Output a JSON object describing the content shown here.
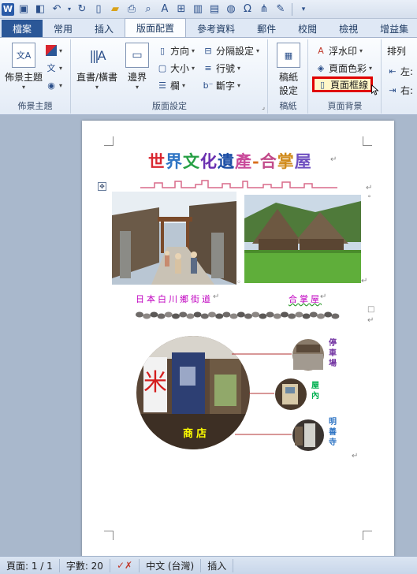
{
  "qat": {
    "icons": [
      "word-logo",
      "save-icon",
      "preview-icon",
      "undo-icon",
      "redo-icon",
      "new-doc-icon",
      "open-icon",
      "print-icon",
      "print-preview-icon",
      "text-box-icon",
      "table-icon",
      "book-icon",
      "image-icon",
      "omega-icon",
      "org-chart-icon",
      "highlighter-icon"
    ]
  },
  "tabs": {
    "file": "檔案",
    "home": "常用",
    "insert": "插入",
    "page_layout": "版面配置",
    "references": "參考資料",
    "mailings": "郵件",
    "review": "校閱",
    "view": "檢視",
    "addins": "增益集"
  },
  "ribbon": {
    "themes": {
      "themes_label": "佈景主題",
      "group_label": "佈景主題"
    },
    "page_setup": {
      "text_direction": "直書/橫書",
      "margins": "邊界",
      "orientation": "方向",
      "size": "大小",
      "columns": "欄",
      "breaks": "分隔設定",
      "line_numbers": "行號",
      "hyphenation": "斷字",
      "group_label": "版面設定"
    },
    "manuscript": {
      "button": "稿紙設定",
      "button_line1": "稿紙",
      "button_line2": "設定",
      "group_label": "稿紙"
    },
    "page_background": {
      "watermark": "浮水印",
      "page_color": "頁面色彩",
      "page_borders": "頁面框線",
      "group_label": "頁面背景"
    },
    "arrange": {
      "label": "排列",
      "indent_left": "左:",
      "indent_right": "右:"
    }
  },
  "document": {
    "title_chars": [
      "世",
      "界",
      "文",
      "化",
      "遺",
      "產",
      "-",
      "合",
      "掌",
      "屋"
    ],
    "title_colors": [
      "#d9262f",
      "#2e74c4",
      "#27a045",
      "#6a2fb0",
      "#1c4ea5",
      "#c94a9a",
      "#d96e1a",
      "#c24a8a",
      "#d08a1a",
      "#6f4fc0"
    ],
    "caption_left": "日本白川鄉街道",
    "caption_right": "合掌屋",
    "shop_label": "商店",
    "side_labels": [
      {
        "text": "停車場",
        "color": "#7030a0"
      },
      {
        "text": "屋內",
        "color": "#00b050"
      },
      {
        "text": "明善寺",
        "color": "#2e74c4"
      }
    ],
    "para_mark": "↵"
  },
  "status": {
    "page": "頁面: 1 / 1",
    "words": "字數: 20",
    "language": "中文 (台灣)",
    "mode": "插入"
  }
}
